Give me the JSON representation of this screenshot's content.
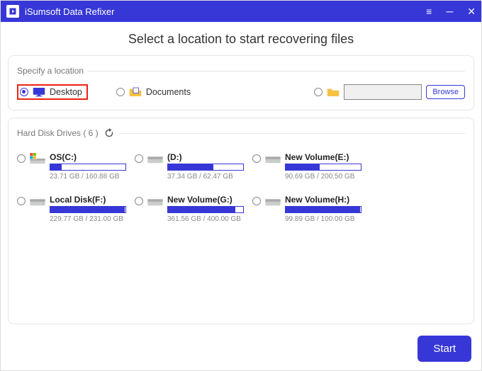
{
  "app": {
    "title": "iSumsoft Data Refixer"
  },
  "heading": "Select a location to start recovering files",
  "specify": {
    "legend": "Specify a location",
    "desktop_label": "Desktop",
    "documents_label": "Documents",
    "browse_label": "Browse"
  },
  "drives_section": {
    "legend": "Hard Disk Drives ( 6 )"
  },
  "drives": [
    {
      "name": "OS(C:)",
      "used": "23.71 GB",
      "total": "160.88 GB",
      "fill": 15,
      "os": true
    },
    {
      "name": "(D:)",
      "used": "37.34 GB",
      "total": "62.47 GB",
      "fill": 60,
      "os": false
    },
    {
      "name": "New Volume(E:)",
      "used": "90.69 GB",
      "total": "200.50 GB",
      "fill": 45,
      "os": false
    },
    {
      "name": "Local Disk(F:)",
      "used": "229.77 GB",
      "total": "231.00 GB",
      "fill": 99,
      "os": false
    },
    {
      "name": "New Volume(G:)",
      "used": "361.56 GB",
      "total": "400.00 GB",
      "fill": 90,
      "os": false
    },
    {
      "name": "New Volume(H:)",
      "used": "99.89 GB",
      "total": "100.00 GB",
      "fill": 99,
      "os": false
    }
  ],
  "start_label": "Start"
}
